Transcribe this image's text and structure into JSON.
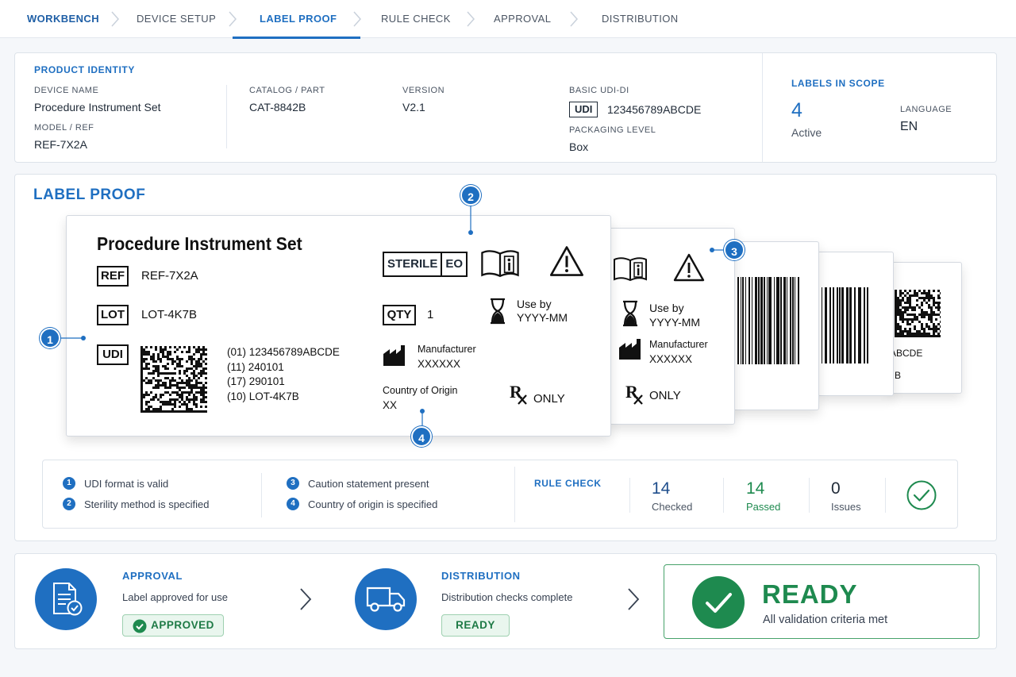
{
  "nav": {
    "steps": [
      "WORKBENCH",
      "DEVICE SETUP",
      "LABEL PROOF",
      "RULE CHECK",
      "APPROVAL",
      "DISTRIBUTION"
    ],
    "active_step": "LABEL PROOF"
  },
  "identity": {
    "heading": "PRODUCT IDENTITY",
    "device_name_label": "DEVICE NAME",
    "device_name": "Procedure Instrument Set",
    "model_label": "MODEL / REF",
    "model": "REF-7X2A",
    "catalog_label": "CATALOG / PART",
    "catalog": "CAT-8842B",
    "version_label": "VERSION",
    "version": "V2.1",
    "udi_label": "BASIC UDI-DI",
    "udi_chip": "UDI",
    "udi_value": "123456789ABCDE",
    "packaging_label": "PACKAGING LEVEL",
    "packaging": "Box"
  },
  "scope": {
    "heading": "LABELS IN SCOPE",
    "count": "4",
    "count_label": "Active",
    "language_label": "LANGUAGE",
    "language": "EN"
  },
  "proof": {
    "title": "LABEL PROOF",
    "label": {
      "product": "Procedure Instrument Set",
      "ref_symbol": "REF",
      "ref": "REF-7X2A",
      "lot_symbol": "LOT",
      "lot": "LOT-4K7B",
      "udi_symbol": "UDI",
      "udi_lines": [
        "(01)  123456789ABCDE",
        "(11)  240101",
        "(17)  290101",
        "(10)  LOT-4K7B"
      ],
      "sterile": "STERILE",
      "sterile_method": "EO",
      "qty_symbol": "QTY",
      "qty": "1",
      "use_by": "Use by",
      "use_by_value": "YYYY-MM",
      "manufacturer": "Manufacturer",
      "manufacturer_value": "XXXXXX",
      "country_label": "Country of Origin",
      "country_value": "XX",
      "rx": "ONLY"
    },
    "label2": {
      "use_by": "Use by",
      "use_by_value": "YYYY-MM",
      "manufacturer": "Manufacturer",
      "manufacturer_value": "XXXXXX",
      "rx": "ONLY"
    },
    "label5_partial": [
      "ABCDE",
      "B"
    ],
    "callouts": [
      "1",
      "2",
      "3",
      "4"
    ]
  },
  "checks": {
    "items": [
      {
        "num": "1",
        "text": "UDI format is valid"
      },
      {
        "num": "2",
        "text": "Sterility method is specified"
      },
      {
        "num": "3",
        "text": "Caution statement present"
      },
      {
        "num": "4",
        "text": "Country of origin is specified"
      }
    ],
    "rule_check_heading": "RULE CHECK",
    "checked": "14",
    "checked_label": "Checked",
    "passed": "14",
    "passed_label": "Passed",
    "issues": "0",
    "issues_label": "Issues"
  },
  "approval": {
    "heading": "APPROVAL",
    "subtitle": "Label approved for use",
    "badge": "APPROVED"
  },
  "distribution": {
    "heading": "DISTRIBUTION",
    "subtitle": "Distribution checks complete",
    "badge": "READY"
  },
  "ready": {
    "title": "READY",
    "subtitle": "All validation criteria met"
  },
  "colors": {
    "accent": "#1f6fc1",
    "success": "#1e8a4f",
    "text": "#1f2a37"
  }
}
